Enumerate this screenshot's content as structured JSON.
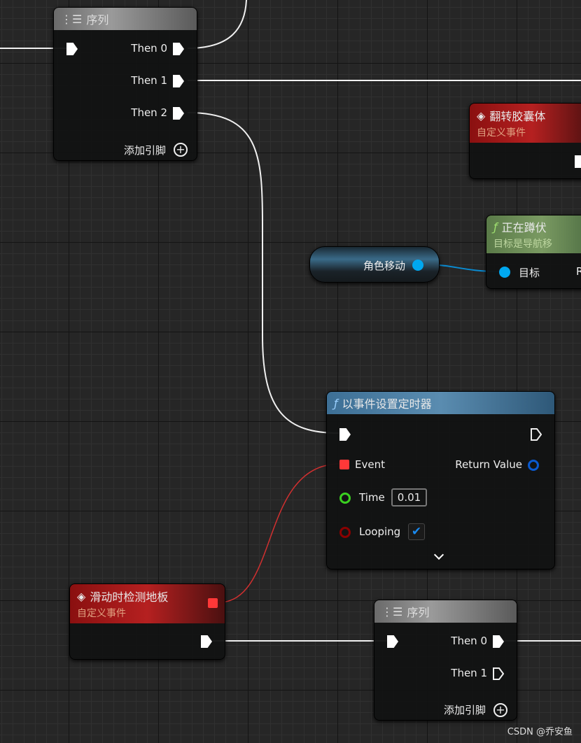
{
  "sequence_top": {
    "title": "序列",
    "pins": [
      "Then 0",
      "Then 1",
      "Then 2"
    ],
    "add_pin": "添加引脚"
  },
  "flip_capsule": {
    "title": "翻转胶囊体",
    "subtitle": "自定义事件"
  },
  "is_crouching": {
    "title": "正在蹲伏",
    "subtitle": "目标是导航移",
    "target": "目标",
    "return_partial": "R"
  },
  "variable": {
    "label": "角色移动"
  },
  "timer": {
    "title": "以事件设置定时器",
    "event": "Event",
    "return_value": "Return Value",
    "time": "Time",
    "time_value": "0.01",
    "looping": "Looping",
    "looping_checked": true
  },
  "slide_event": {
    "title": "滑动时检测地板",
    "subtitle": "自定义事件"
  },
  "sequence_bottom": {
    "title": "序列",
    "pins": [
      "Then 0",
      "Then 1"
    ],
    "add_pin": "添加引脚"
  },
  "watermark": "CSDN @乔安鱼",
  "colors": {
    "exec": "#ffffff",
    "object": "#00a8f0",
    "delegate": "#ff3838",
    "float": "#3ad020",
    "bool": "#8a0000",
    "return_obj": "#0a5ad0"
  }
}
